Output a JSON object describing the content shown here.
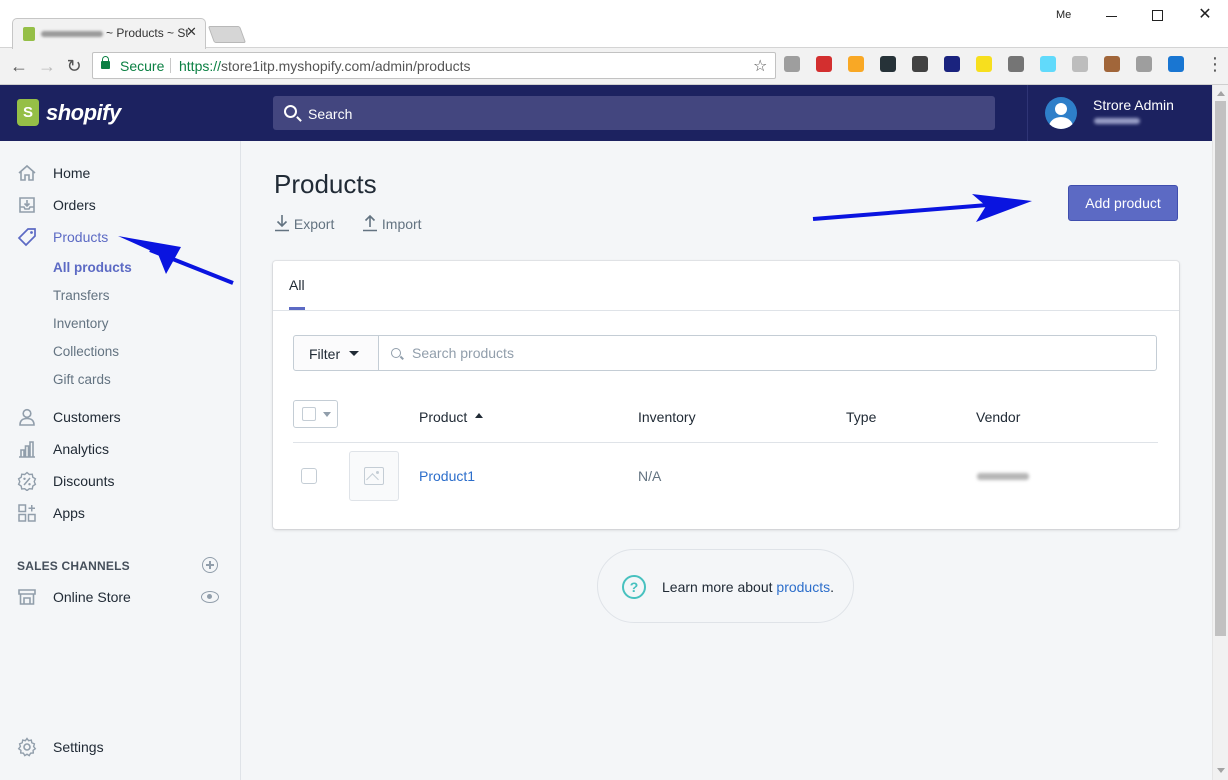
{
  "browser": {
    "tab_title": "~ Products ~ St",
    "tab_close": "✕",
    "window_user": "Me",
    "secure_label": "Secure",
    "url_scheme": "https://",
    "url_host": "store1itp.myshopify.com",
    "url_path": "/admin/products",
    "back_glyph": "←",
    "forward_glyph": "→",
    "reload_glyph": "↻",
    "star_glyph": "☆",
    "menu_glyph": "⋮",
    "close_glyph": "✕",
    "extensions": [
      {
        "name": "globe-extension-icon",
        "color": "#9e9e9e"
      },
      {
        "name": "lock-extension-icon",
        "color": "#d32f2f"
      },
      {
        "name": "paw-extension-icon",
        "color": "#f9a825"
      },
      {
        "name": "e-extension-icon",
        "color": "#263238"
      },
      {
        "name": "jb-extension-icon",
        "color": "#424242"
      },
      {
        "name": "react-dark-extension-icon",
        "color": "#1a237e"
      },
      {
        "name": "js-extension-icon",
        "color": "#f7df1e"
      },
      {
        "name": "bug-extension-icon",
        "color": "#757575"
      },
      {
        "name": "react-extension-icon",
        "color": "#61dafb"
      },
      {
        "name": "brackets-extension-icon",
        "color": "#bdbdbd"
      },
      {
        "name": "cookie-extension-icon",
        "color": "#a1663a"
      },
      {
        "name": "resize-extension-icon",
        "color": "#9e9e9e"
      },
      {
        "name": "pocket-extension-icon",
        "color": "#1976d2"
      }
    ]
  },
  "topbar": {
    "logo_text": "shopify",
    "search_label": "Search",
    "user_name": "Strore Admin"
  },
  "sidebar": {
    "items": [
      {
        "label": "Home",
        "icon": "home-icon"
      },
      {
        "label": "Orders",
        "icon": "orders-icon"
      },
      {
        "label": "Products",
        "icon": "tag-icon",
        "active": true
      },
      {
        "label": "Customers",
        "icon": "person-icon"
      },
      {
        "label": "Analytics",
        "icon": "bar-chart-icon"
      },
      {
        "label": "Discounts",
        "icon": "discount-icon"
      },
      {
        "label": "Apps",
        "icon": "apps-icon"
      }
    ],
    "product_subitems": [
      {
        "label": "All products",
        "active": true
      },
      {
        "label": "Transfers"
      },
      {
        "label": "Inventory"
      },
      {
        "label": "Collections"
      },
      {
        "label": "Gift cards"
      }
    ],
    "sales_channels_title": "SALES CHANNELS",
    "online_store_label": "Online Store",
    "settings_label": "Settings"
  },
  "main": {
    "title": "Products",
    "export_label": "Export",
    "import_label": "Import",
    "add_product_label": "Add product",
    "tab_all": "All",
    "filter_label": "Filter",
    "search_placeholder": "Search products",
    "columns": {
      "product": "Product",
      "inventory": "Inventory",
      "type": "Type",
      "vendor": "Vendor"
    },
    "rows": [
      {
        "product": "Product1",
        "inventory": "N/A",
        "type": ""
      }
    ],
    "learn_prefix": "Learn more about ",
    "learn_link": "products",
    "learn_suffix": ".",
    "help_glyph": "?"
  },
  "colors": {
    "topbar": "#1c2260",
    "accent": "#5c6ac4",
    "link": "#2c6ecb",
    "annotation_arrow": "#0a14e0"
  }
}
